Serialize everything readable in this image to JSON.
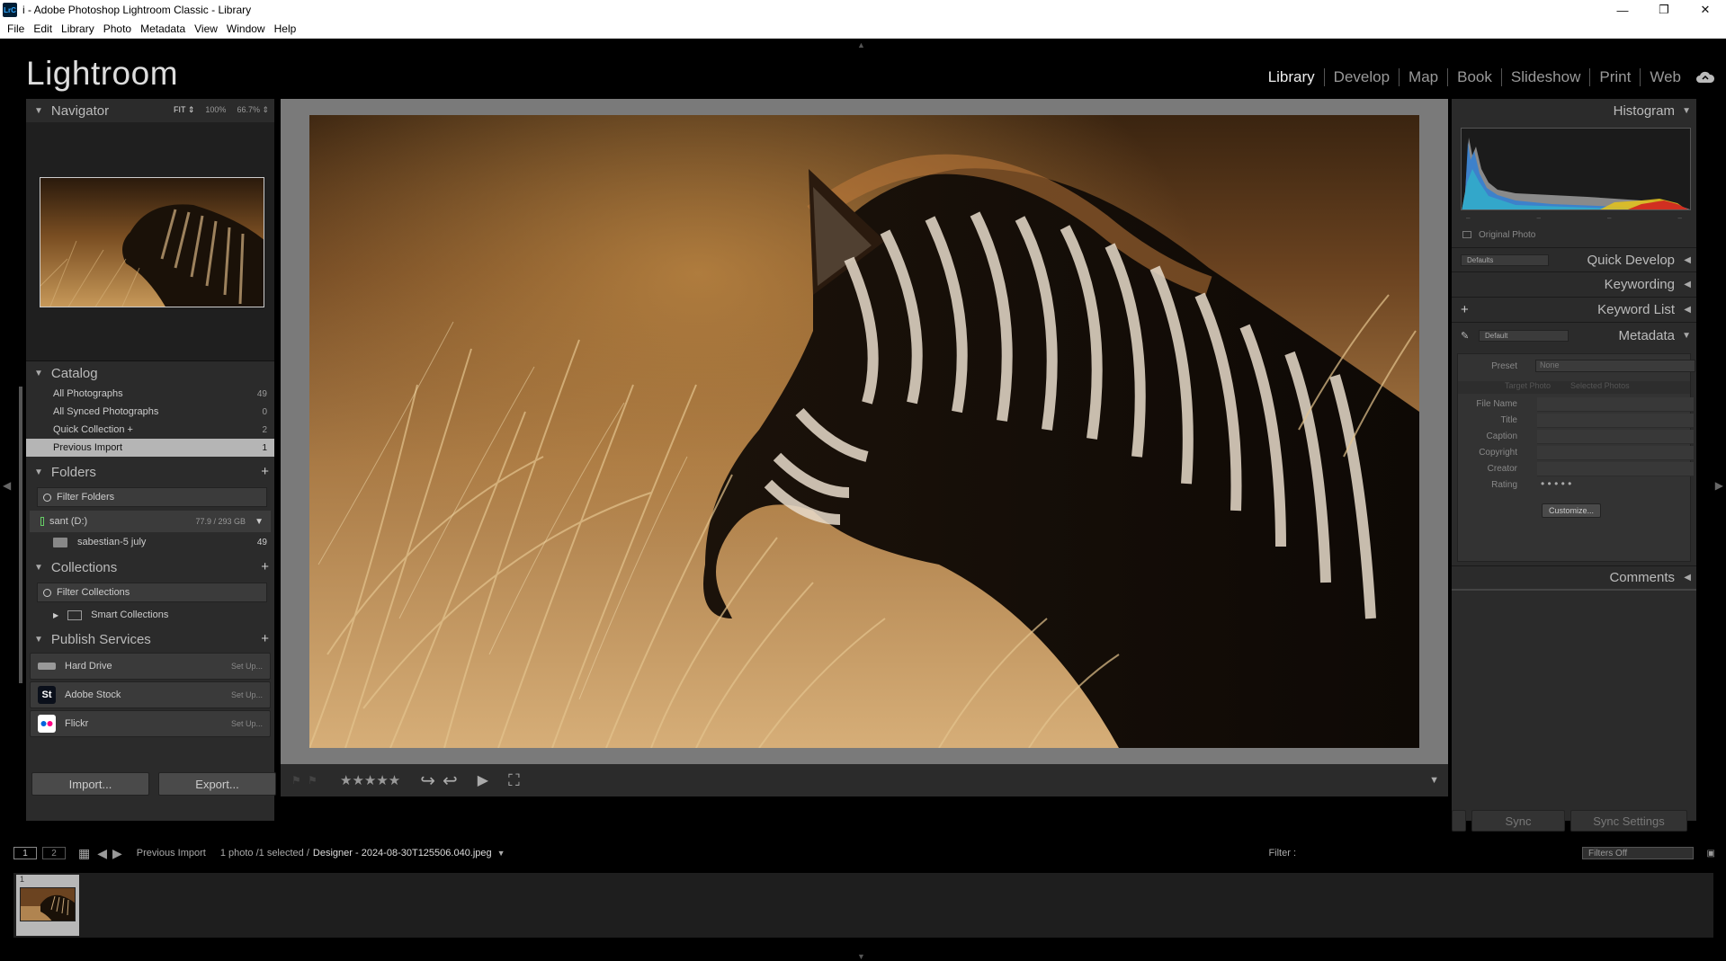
{
  "window": {
    "icon_label": "LrC",
    "title": "i - Adobe Photoshop Lightroom Classic - Library",
    "controls": [
      "—",
      "❐",
      "✕"
    ]
  },
  "menu": [
    "File",
    "Edit",
    "Library",
    "Photo",
    "Metadata",
    "View",
    "Window",
    "Help"
  ],
  "header": {
    "logo": "Lightroom",
    "modules": [
      "Library",
      "Develop",
      "Map",
      "Book",
      "Slideshow",
      "Print",
      "Web"
    ],
    "active_module": "Library"
  },
  "navigator": {
    "title": "Navigator",
    "options": [
      "FIT ⇕",
      "100%",
      "66.7% ⇕"
    ]
  },
  "catalog": {
    "title": "Catalog",
    "rows": [
      {
        "label": "All Photographs",
        "count": "49"
      },
      {
        "label": "All Synced Photographs",
        "count": "0"
      },
      {
        "label": "Quick Collection +",
        "count": "2"
      },
      {
        "label": "Previous Import",
        "count": "1"
      }
    ]
  },
  "folders": {
    "title": "Folders",
    "filter_placeholder": "Filter Folders",
    "volume": {
      "name": "sant (D:)",
      "size": "77.9 / 293 GB"
    },
    "items": [
      {
        "label": "sabestian-5 july",
        "count": "49"
      }
    ]
  },
  "collections": {
    "title": "Collections",
    "filter_placeholder": "Filter Collections",
    "items": [
      {
        "label": "Smart Collections"
      }
    ]
  },
  "publish": {
    "title": "Publish Services",
    "services": [
      {
        "label": "Hard Drive",
        "action": "Set Up..."
      },
      {
        "label": "Adobe Stock",
        "icon_text": "St",
        "action": "Set Up..."
      },
      {
        "label": "Flickr",
        "action": "Set Up..."
      }
    ]
  },
  "left_buttons": {
    "import": "Import...",
    "export": "Export..."
  },
  "toolbar": {
    "stars": "★★★★★",
    "dropdown": "▼"
  },
  "right": {
    "histogram_title": "Histogram",
    "original_photo": "Original Photo",
    "quick_develop": {
      "title": "Quick Develop",
      "preset": "Defaults"
    },
    "keywording": "Keywording",
    "keyword_list": "Keyword List",
    "metadata": {
      "title": "Metadata",
      "preset_select": "Default",
      "preset_label": "Preset",
      "preset_value": "None",
      "target_photo": "Target Photo",
      "selected_photos": "Selected Photos",
      "fields": [
        "File Name",
        "Title",
        "Caption",
        "Copyright",
        "Creator",
        "Rating"
      ],
      "rating_dots": "• • • • •",
      "customize": "Customize..."
    },
    "comments": "Comments",
    "sync": "Sync",
    "sync_settings": "Sync Settings"
  },
  "filmstrip": {
    "page1": "1",
    "page2": "2",
    "source": "Previous Import",
    "count": "1 photo /1 selected /",
    "filename": "Designer - 2024-08-30T125506.040.jpeg",
    "filter_label": "Filter :",
    "filter_value": "Filters Off",
    "cell_number": "1"
  }
}
